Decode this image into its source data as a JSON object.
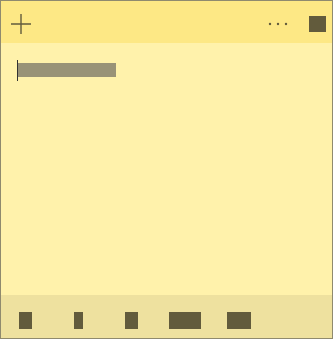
{
  "window": {
    "new_note_icon": "plus-icon",
    "menu_icon": "ellipsis-icon",
    "close_icon": "close-icon"
  },
  "note": {
    "body_text": ""
  },
  "toolbar": {
    "buttons": [
      {
        "name": "bold",
        "icon": "bold-icon"
      },
      {
        "name": "italic",
        "icon": "italic-icon"
      },
      {
        "name": "underline",
        "icon": "underline-icon"
      },
      {
        "name": "strikethrough",
        "icon": "strikethrough-icon"
      },
      {
        "name": "bullets",
        "icon": "bullets-icon"
      }
    ]
  },
  "colors": {
    "note_background": "#fff2ab",
    "titlebar_background": "#fde885",
    "toolbar_background": "#eee19f",
    "icon_color": "#625b3c",
    "selection_color": "#999377"
  }
}
